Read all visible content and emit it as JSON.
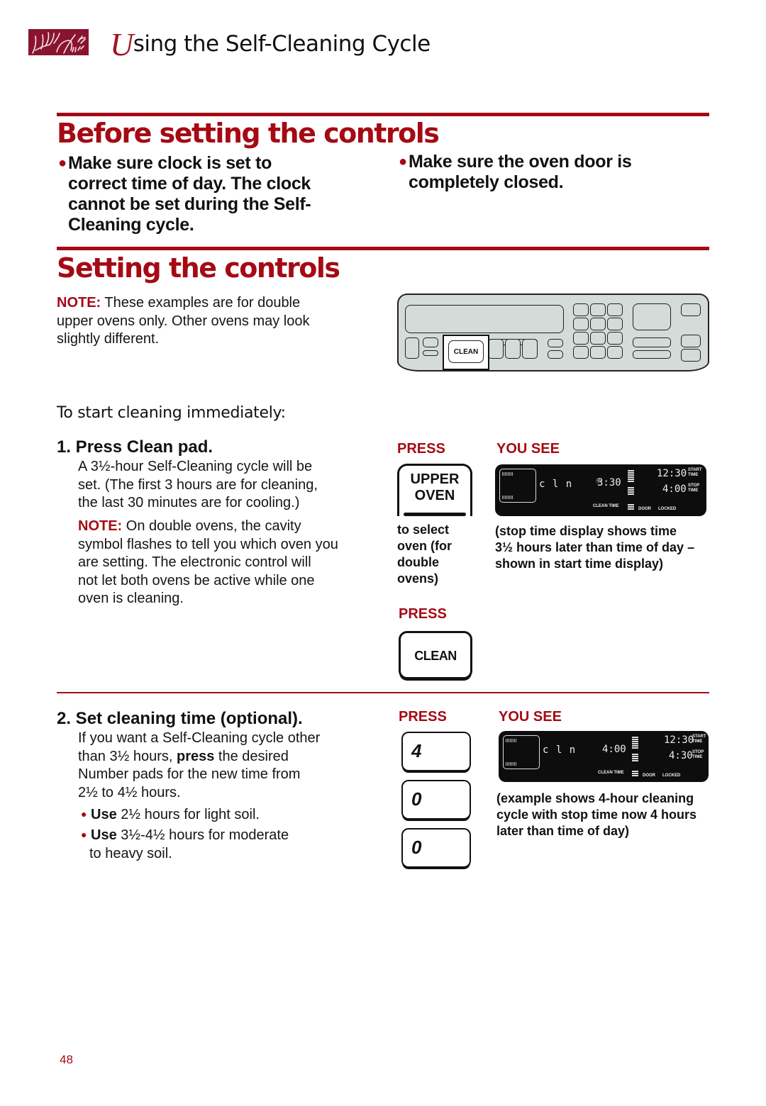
{
  "header": {
    "logo_icon": "decorative-wheat-grass-logo",
    "title_initial": "U",
    "title_rest": "sing the Self-Cleaning Cycle"
  },
  "colors": {
    "accent": "#a50a14",
    "logo_bg": "#8a1330",
    "panel_bg": "#d4dbd9",
    "display_bg": "#0d0d0d"
  },
  "before_section": {
    "title": "Before setting the controls",
    "bullets": [
      {
        "lines": [
          "Make sure clock is set to",
          "correct time of day. The clock",
          "cannot be set during the Self-",
          "Cleaning cycle."
        ]
      },
      {
        "lines": [
          "Make sure the oven door is",
          "completely closed."
        ]
      }
    ]
  },
  "setting_section": {
    "title": "Setting the controls",
    "note": {
      "label": "NOTE:",
      "lines": [
        " These examples are for double",
        "upper ovens only. Other ovens may look",
        "slightly different."
      ]
    },
    "panel": {
      "highlighted_key": "CLEAN"
    },
    "subhead": "To start cleaning immediately:",
    "step1": {
      "title": "1. Press Clean pad.",
      "body_lines": [
        "A 3½-hour Self-Cleaning cycle will be",
        "set. (The first 3 hours are for cleaning,",
        "the last 30 minutes are for cooling.)"
      ],
      "note_label": "NOTE:",
      "note_lines": [
        " On double ovens, the cavity",
        "symbol flashes to tell you which oven you",
        "are setting. The electronic control will",
        "not let both ovens be active while one",
        "oven is cleaning."
      ],
      "press_label": "PRESS",
      "you_see_label": "YOU SEE",
      "upper_oven_pad": [
        "UPPER",
        "OVEN"
      ],
      "upper_oven_caption": [
        "to select",
        "oven (for",
        "double",
        "ovens)"
      ],
      "display": {
        "mode": "c l n",
        "clean_time": "3:30",
        "clean_time_label": "CLEAN TIME",
        "start_time": "12:30",
        "start_label": [
          "START",
          "TIME"
        ],
        "stop_time": "4:00",
        "stop_label": [
          "STOP",
          "TIME"
        ],
        "door_label": "DOOR",
        "locked_label": "LOCKED"
      },
      "display_caption": [
        "(stop time display shows time",
        "3½ hours later than time of day –",
        "shown in start time display)"
      ],
      "press_label_2": "PRESS",
      "clean_pad": "CLEAN"
    },
    "step2": {
      "title": "2. Set cleaning time (optional).",
      "body_lines_1": "If you want a Self-Cleaning cycle other",
      "body_line_2_pre": "than 3½ hours, ",
      "body_line_2_bold": "press",
      "body_line_2_post": " the desired",
      "body_lines_3": "Number pads for the new time from",
      "body_lines_4": "2½ to 4½ hours.",
      "bullets": [
        {
          "bold": "Use",
          "text": " 2½ hours for light soil.",
          "text2": ""
        },
        {
          "bold": "Use",
          "text": " 3½-4½ hours for moderate",
          "text2": "to heavy soil."
        }
      ],
      "press_label": "PRESS",
      "you_see_label": "YOU SEE",
      "number_pads": [
        "4",
        "0",
        "0"
      ],
      "display": {
        "mode": "c l n",
        "clean_time": "4:00",
        "clean_time_label": "CLEAN TIME",
        "start_time": "12:30",
        "start_label": [
          "START",
          "TIME"
        ],
        "stop_time": "4:30",
        "stop_label": [
          "STOP",
          "TIME"
        ],
        "door_label": "DOOR",
        "locked_label": "LOCKED"
      },
      "display_caption": [
        "(example shows 4-hour cleaning",
        "cycle with stop time now 4 hours",
        "later than time of day)"
      ]
    }
  },
  "page_number": "48"
}
